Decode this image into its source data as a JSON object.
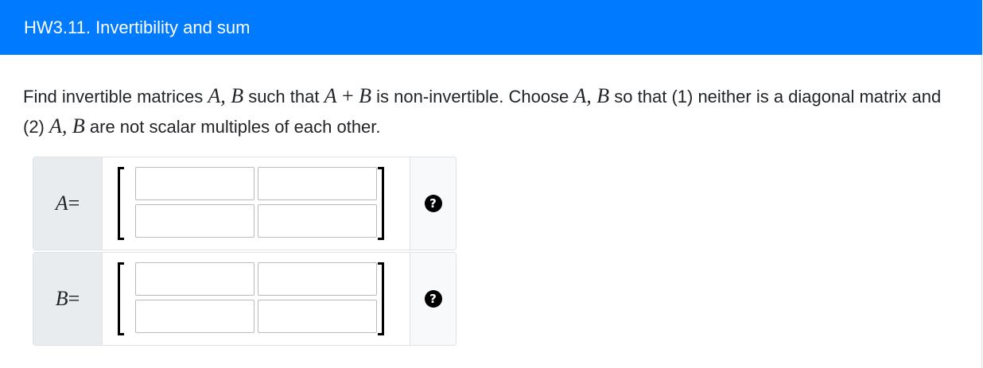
{
  "header": {
    "title": "HW3.11. Invertibility and sum"
  },
  "question": {
    "t1": "Find invertible matrices ",
    "m1": "A, B",
    "t2": " such that ",
    "m2a": "A",
    "m2op": " + ",
    "m2b": "B",
    "t3": " is non-invertible. Choose ",
    "m3": "A, B",
    "t4": " so that (1) neither is a diagonal matrix and (2) ",
    "m4": "A, B",
    "t5": " are not scalar multiples of each other."
  },
  "matrix_a": {
    "label": "A",
    "eq": " =",
    "entries": [
      "",
      "",
      "",
      ""
    ],
    "help_icon": "question-circle-icon",
    "help_glyph": "?"
  },
  "matrix_b": {
    "label": "B",
    "eq": " =",
    "entries": [
      "",
      "",
      "",
      ""
    ],
    "help_icon": "question-circle-icon",
    "help_glyph": "?"
  },
  "colors": {
    "header_bg": "#007bff",
    "label_bg": "#e9ecef",
    "help_bg": "#f8f9fa"
  }
}
